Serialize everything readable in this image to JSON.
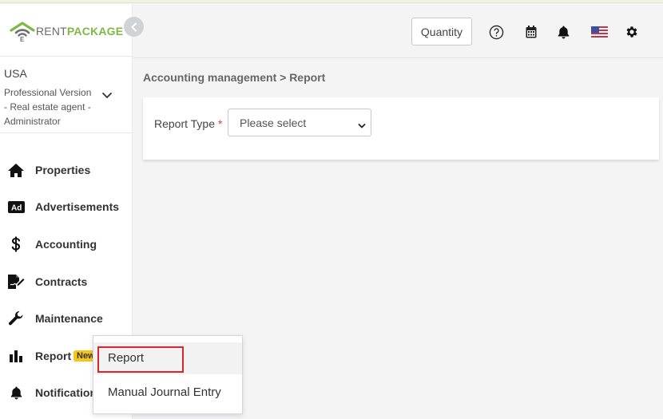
{
  "brand": {
    "name_part1": "RENT",
    "name_part2": "PACKAGE",
    "green": "#7db945",
    "wifi_green": "#7db945"
  },
  "account": {
    "country": "USA",
    "line1": "Professional Version",
    "line2": "- Real estate agent -",
    "line3": "Administrator"
  },
  "nav": [
    {
      "label": "Properties",
      "icon": "home-icon"
    },
    {
      "label": "Advertisements",
      "icon": "ad-icon"
    },
    {
      "label": "Accounting",
      "icon": "dollar-icon"
    },
    {
      "label": "Contracts",
      "icon": "contract-icon"
    },
    {
      "label": "Maintenance",
      "icon": "wrench-icon"
    },
    {
      "label": "Report",
      "icon": "bar-chart-icon",
      "badge": "New"
    },
    {
      "label": "Notifications",
      "icon": "bell-icon"
    }
  ],
  "header": {
    "quantity_label": "Quantity",
    "icons": [
      "help-icon",
      "calendar-icon",
      "bell-icon",
      "us-flag-icon",
      "gear-icon"
    ]
  },
  "breadcrumb": "Accounting management > Report",
  "report_form": {
    "label": "Report Type",
    "required_mark": "*",
    "select_value": "Please select"
  },
  "submenu": {
    "items": [
      "Report",
      "Manual Journal Entry"
    ]
  },
  "colors": {
    "highlight_box": "#d9262c",
    "badge": "#f5c518",
    "required": "#e0443b"
  }
}
